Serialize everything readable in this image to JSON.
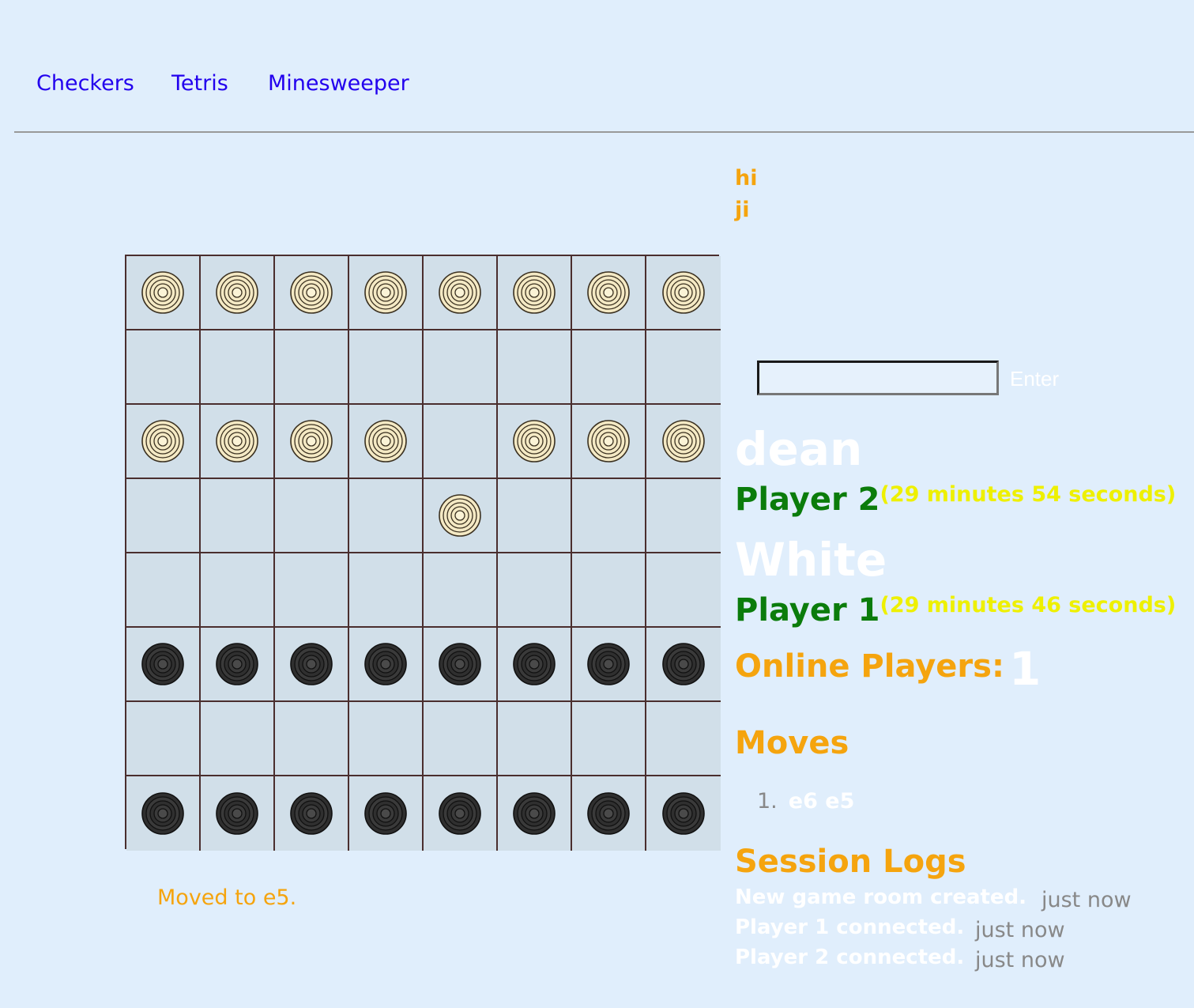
{
  "nav": {
    "links": [
      "Checkers",
      "Tetris",
      "Minesweeper"
    ]
  },
  "chat": {
    "messages": [
      "hi",
      "ji"
    ],
    "input_value": "",
    "enter_label": "Enter"
  },
  "board": {
    "light_square_color": "#d1dfe9",
    "grid_color": "#4a2e2e",
    "rows": [
      [
        "W",
        "W",
        "W",
        "W",
        "W",
        "W",
        "W",
        "W"
      ],
      [
        "",
        "",
        "",
        "",
        "",
        "",
        "",
        ""
      ],
      [
        "W",
        "W",
        "W",
        "W",
        "",
        "W",
        "W",
        "W"
      ],
      [
        "",
        "",
        "",
        "",
        "W",
        "",
        "",
        ""
      ],
      [
        "",
        "",
        "",
        "",
        "",
        "",
        "",
        ""
      ],
      [
        "B",
        "B",
        "B",
        "B",
        "B",
        "B",
        "B",
        "B"
      ],
      [
        "",
        "",
        "",
        "",
        "",
        "",
        "",
        ""
      ],
      [
        "B",
        "B",
        "B",
        "B",
        "B",
        "B",
        "B",
        "B"
      ]
    ],
    "piece_colors": {
      "W": "#f4e9c4",
      "B": "#2f2f2f"
    }
  },
  "status": "Moved to e5.",
  "players": {
    "top_name": "dean",
    "player2_label": "Player 2",
    "player2_timer": "(29 minutes 54 seconds)",
    "side_label": "White",
    "player1_label": "Player 1",
    "player1_timer": "(29 minutes 46 seconds)"
  },
  "online": {
    "label": "Online Players:",
    "count": "1"
  },
  "moves": {
    "title": "Moves",
    "items": [
      {
        "num": "1.",
        "text": "e6 e5"
      }
    ]
  },
  "logs": {
    "title": "Session Logs",
    "items": [
      {
        "text": "New game room created.",
        "time": "just now"
      },
      {
        "text": "Player 1 connected.",
        "time": "just now"
      },
      {
        "text": "Player 2 connected.",
        "time": "just now"
      }
    ]
  },
  "colors": {
    "background": "#e0eefc",
    "accent_orange": "#f5a40e",
    "player_green": "#0b7c0b",
    "timer_yellow": "#eef000",
    "link_blue": "#2200ee"
  }
}
